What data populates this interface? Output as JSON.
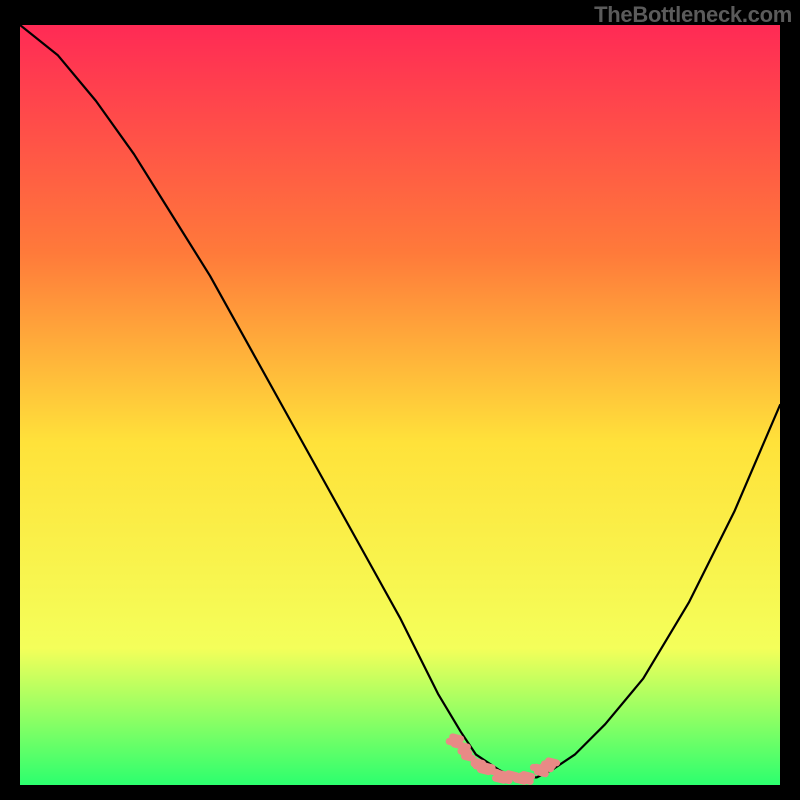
{
  "watermark": "TheBottleneck.com",
  "gradient": {
    "top": "#ff2a55",
    "upper": "#ff7a3a",
    "mid": "#ffe23a",
    "lower": "#f4ff5a",
    "bottom": "#2cff6e"
  },
  "curve_color": "#000000",
  "marker_color": "#e88a86",
  "chart_data": {
    "type": "line",
    "title": "",
    "xlabel": "",
    "ylabel": "",
    "xlim": [
      0,
      100
    ],
    "ylim": [
      0,
      100
    ],
    "series": [
      {
        "name": "bottleneck-curve",
        "x": [
          0,
          5,
          10,
          15,
          20,
          25,
          30,
          35,
          40,
          45,
          50,
          53,
          55,
          58,
          60,
          63,
          65,
          68,
          70,
          73,
          77,
          82,
          88,
          94,
          100
        ],
        "values": [
          100,
          96,
          90,
          83,
          75,
          67,
          58,
          49,
          40,
          31,
          22,
          16,
          12,
          7,
          4,
          2,
          1,
          1,
          2,
          4,
          8,
          14,
          24,
          36,
          50
        ]
      }
    ],
    "markers": {
      "name": "highlight-band",
      "x": [
        57,
        58,
        59,
        60,
        61,
        62,
        63,
        64,
        65,
        66,
        67,
        68,
        69,
        70
      ],
      "values": [
        6,
        5,
        4,
        3,
        2,
        2,
        1,
        1,
        1,
        1,
        1,
        2,
        2,
        3
      ]
    }
  }
}
